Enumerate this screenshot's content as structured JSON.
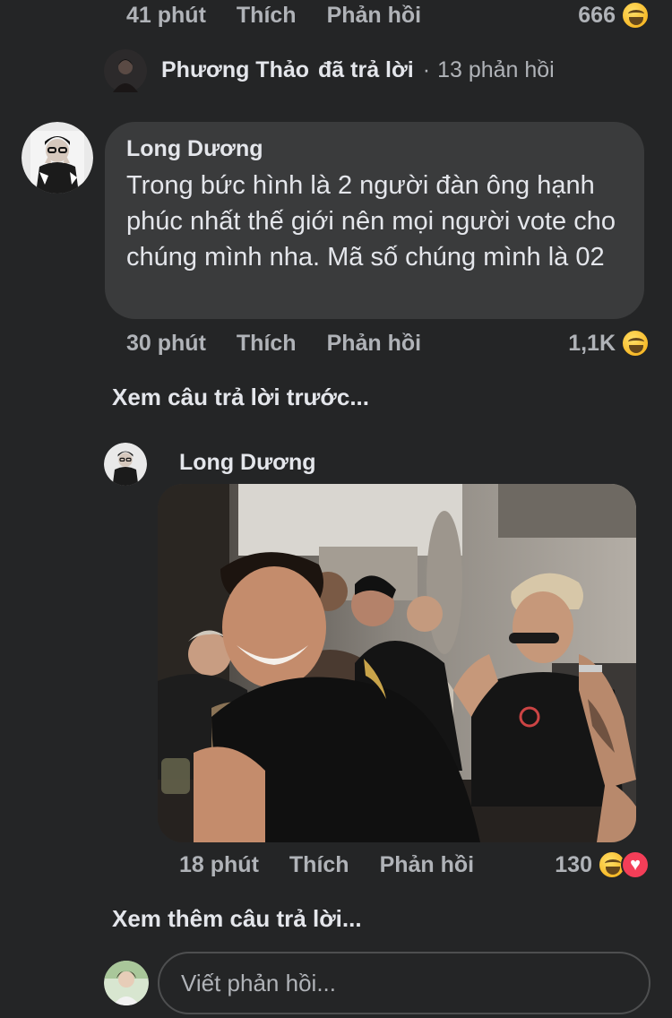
{
  "top_comment": {
    "time": "41 phút",
    "like": "Thích",
    "reply": "Phản hồi",
    "reaction_count": "666",
    "reaction_icons": [
      "haha-icon"
    ]
  },
  "reply_summary": {
    "name": "Phương Thảo",
    "verb": "đã trả lời",
    "separator": "·",
    "replies": "13 phản hồi"
  },
  "comment": {
    "author": "Long Dương",
    "text": "Trong bức hình là 2 người đàn ông hạnh phúc nhất thế giới nên mọi người vote cho chúng mình nha. Mã số chúng mình là 02",
    "time": "30 phút",
    "like": "Thích",
    "reply": "Phản hồi",
    "reaction_count": "1,1K",
    "reaction_icons": [
      "haha-icon"
    ]
  },
  "see_previous": "Xem câu trả lời trước...",
  "reply": {
    "author": "Long Dương",
    "time": "18 phút",
    "like": "Thích",
    "reply": "Phản hồi",
    "reaction_count": "130",
    "reaction_icons": [
      "haha-icon",
      "love-icon"
    ]
  },
  "see_more": "Xem thêm câu trả lời...",
  "composer": {
    "placeholder": "Viết phản hồi..."
  },
  "colors": {
    "background": "#242526",
    "bubble": "#3a3b3c",
    "text_primary": "#e4e6eb",
    "text_secondary": "#b0b3b8"
  }
}
